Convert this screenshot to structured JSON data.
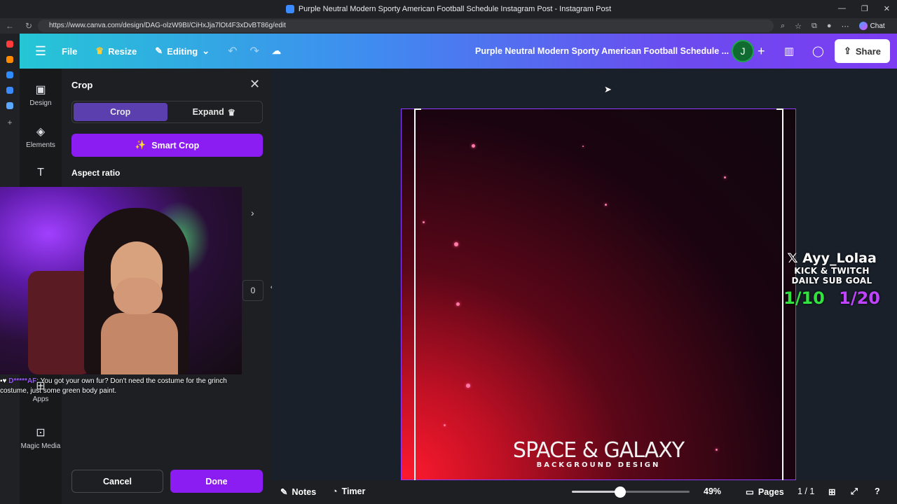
{
  "browser": {
    "tab_title": "Purple Neutral Modern Sporty American Football Schedule Instagram Post - Instagram Post",
    "url": "https://www.canva.com/design/DAG-olzW9BI/CiHxJja7lOt4F3xDvBT86g/edit",
    "chat_label": "Chat"
  },
  "topbar": {
    "file": "File",
    "resize": "Resize",
    "editing": "Editing",
    "doc_title": "Purple Neutral Modern Sporty American Football Schedule ...",
    "avatar_letter": "J",
    "share": "Share"
  },
  "rail": [
    {
      "label": "Design",
      "icon": "design-icon"
    },
    {
      "label": "Elements",
      "icon": "elements-icon"
    },
    {
      "label": "Apps",
      "icon": "apps-icon"
    },
    {
      "label": "Magic Media",
      "icon": "magic-media-icon"
    }
  ],
  "crop_panel": {
    "title": "Crop",
    "tab_crop": "Crop",
    "tab_expand": "Expand",
    "smart_crop": "Smart Crop",
    "aspect_ratio": "Aspect ratio",
    "rotation_value": "0",
    "cancel": "Cancel",
    "done": "Done"
  },
  "chat_overlay": {
    "username": "D*****AF",
    "message": ": You got your own fur? Don't need the costume for the grinch costume, just some green body paint."
  },
  "canvas": {
    "title_line1": "SPACE & GALAXY",
    "title_line2": "BACKGROUND DESIGN"
  },
  "stream_overlay": {
    "x_icon": "𝕏",
    "name": "Ayy_Lolaa",
    "line1": "KICK & TWITCH",
    "line2": "DAILY SUB GOAL",
    "goal1": "1/10",
    "goal2": "1/20"
  },
  "bottom_bar": {
    "notes": "Notes",
    "timer": "Timer",
    "zoom": "49%",
    "zoom_fraction": 0.41,
    "pages": "Pages",
    "page_count": "1 / 1"
  },
  "colors": {
    "accent": "#8b1cf2",
    "goal_green": "#31e33f",
    "goal_purple": "#c044ff"
  }
}
